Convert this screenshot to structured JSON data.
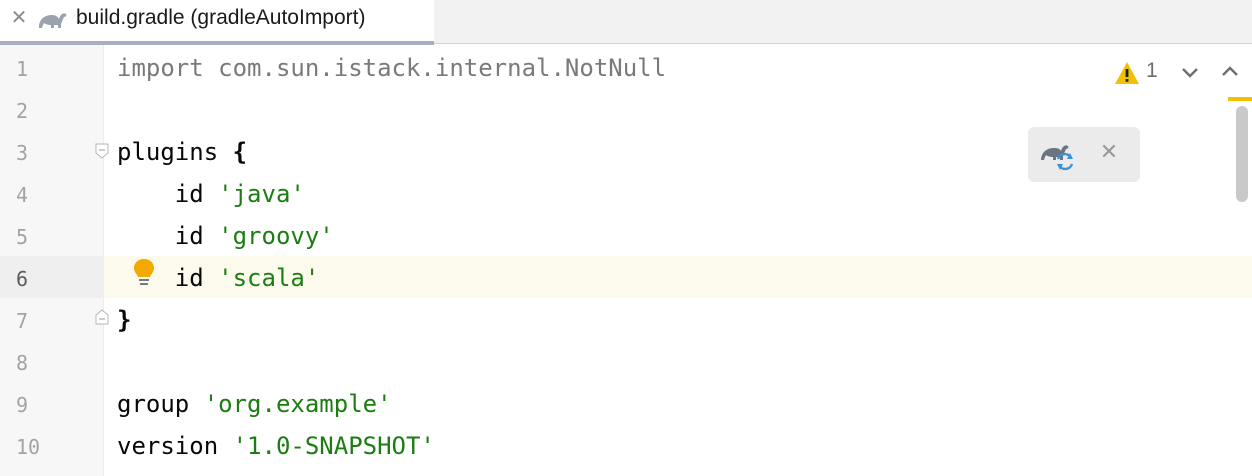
{
  "tab": {
    "title": "build.gradle (gradleAutoImport)",
    "close_glyph": "✕",
    "icon": "gradle-elephant-icon"
  },
  "editor": {
    "current_line": 6,
    "line_numbers": [
      "1",
      "2",
      "3",
      "4",
      "5",
      "6",
      "7",
      "8",
      "9",
      "10"
    ],
    "lines": [
      {
        "segments": [
          {
            "text": "import com.sun.istack.internal.NotNull",
            "style": "grey"
          }
        ]
      },
      {
        "segments": []
      },
      {
        "segments": [
          {
            "text": "plugins ",
            "style": "plain"
          },
          {
            "text": "{",
            "style": "bold"
          }
        ]
      },
      {
        "segments": [
          {
            "text": "    id ",
            "style": "plain"
          },
          {
            "text": "'java'",
            "style": "string"
          }
        ]
      },
      {
        "segments": [
          {
            "text": "    id ",
            "style": "plain"
          },
          {
            "text": "'groovy'",
            "style": "string"
          }
        ]
      },
      {
        "segments": [
          {
            "text": "    id ",
            "style": "plain"
          },
          {
            "text": "'scala'",
            "style": "string"
          }
        ]
      },
      {
        "segments": [
          {
            "text": "}",
            "style": "bold"
          }
        ]
      },
      {
        "segments": []
      },
      {
        "segments": [
          {
            "text": "group ",
            "style": "plain"
          },
          {
            "text": "'org.example'",
            "style": "string"
          }
        ]
      },
      {
        "segments": [
          {
            "text": "version ",
            "style": "plain"
          },
          {
            "text": "'1.0-SNAPSHOT'",
            "style": "string"
          }
        ]
      }
    ]
  },
  "inspections": {
    "warning_count": "1",
    "icon": "warning-icon"
  },
  "gradle_popup": {
    "icon": "gradle-reload-icon",
    "close_glyph": "✕"
  },
  "colors": {
    "string": "#1b7d12",
    "warning": "#f2c200",
    "current_line_bg": "#fcfaed"
  }
}
